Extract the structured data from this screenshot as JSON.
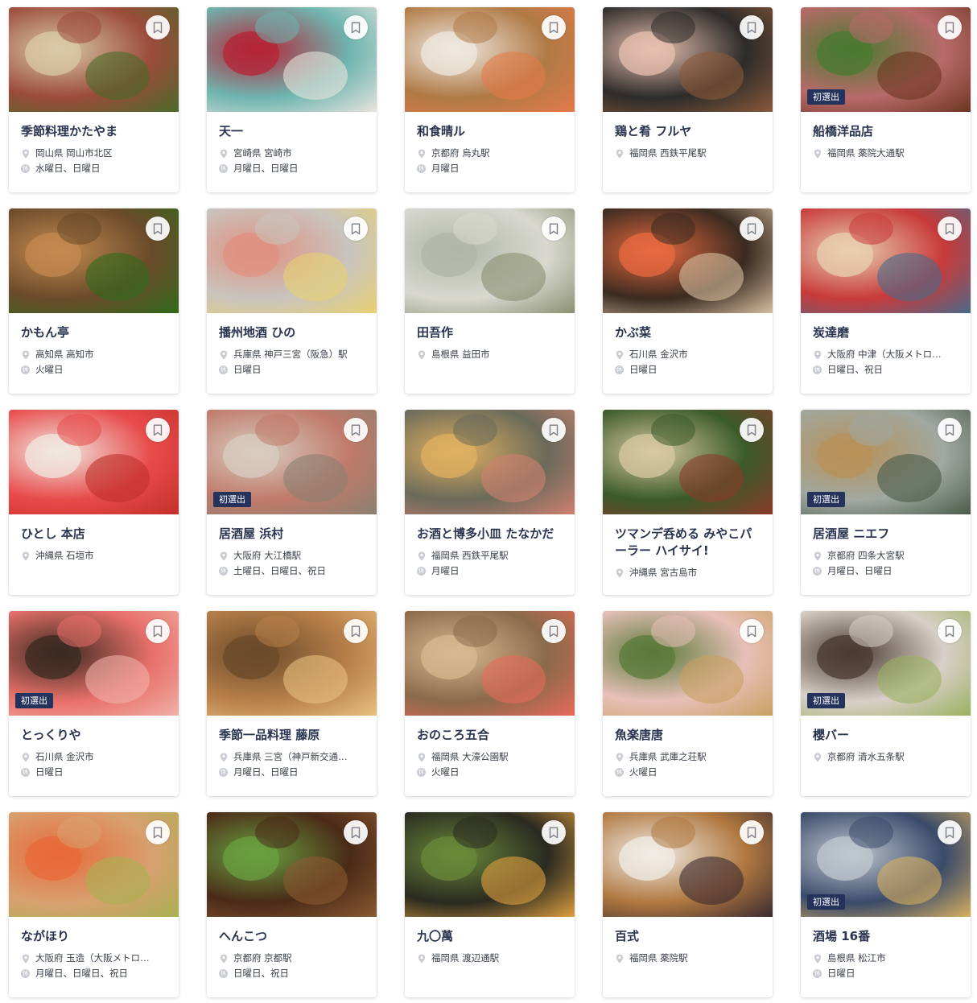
{
  "icons": {
    "bookmark": "bookmark-icon",
    "location": "location-pin-icon",
    "holiday": "holiday-icon"
  },
  "holiday_glyph": "休",
  "badge_label": "初選出",
  "colors": {
    "badge_bg": "#25325c",
    "name": "#2a3450"
  },
  "restaurants": [
    {
      "name": "季節料理かたやま",
      "location": "岡山県 岡山市北区",
      "holidays": "水曜日、日曜日",
      "badge": false,
      "palette": [
        "#9b4b3a",
        "#d9c9a8",
        "#4a6b2a"
      ]
    },
    {
      "name": "天一",
      "location": "宮崎県 宮崎市",
      "holidays": "月曜日、日曜日",
      "badge": false,
      "palette": [
        "#6fb5b0",
        "#b42436",
        "#e8e4dc"
      ]
    },
    {
      "name": "和食晴ル",
      "location": "京都府 烏丸駅",
      "holidays": "月曜日",
      "badge": false,
      "palette": [
        "#b07a45",
        "#efe8e0",
        "#e37a4a"
      ]
    },
    {
      "name": "鶏と肴 フルヤ",
      "location": "福岡県 西鉄平尾駅",
      "holidays": "",
      "badge": false,
      "palette": [
        "#2d2b2a",
        "#e8c0b0",
        "#8a5a3a"
      ]
    },
    {
      "name": "船橋洋品店",
      "location": "福岡県 薬院大通駅",
      "holidays": "",
      "badge": true,
      "palette": [
        "#b86a6a",
        "#4a7a30",
        "#6b3520"
      ]
    },
    {
      "name": "かもん亭",
      "location": "高知県 高知市",
      "holidays": "火曜日",
      "badge": false,
      "palette": [
        "#6a4a2a",
        "#c48a50",
        "#2f6a1a"
      ]
    },
    {
      "name": "播州地酒 ひの",
      "location": "兵庫県 神戸三宮（阪急）駅",
      "holidays": "日曜日",
      "badge": false,
      "palette": [
        "#c9c4be",
        "#e09080",
        "#e8d070"
      ]
    },
    {
      "name": "田吾作",
      "location": "島根県 益田市",
      "holidays": "",
      "badge": false,
      "palette": [
        "#d8d8d0",
        "#b0b6a8",
        "#8a9070"
      ]
    },
    {
      "name": "かぶ菜",
      "location": "石川県 金沢市",
      "holidays": "日曜日",
      "badge": false,
      "palette": [
        "#3a2a20",
        "#e86a40",
        "#d8c0a0"
      ]
    },
    {
      "name": "炭達磨",
      "location": "大阪府 中津（大阪メトロ…",
      "holidays": "日曜日、祝日",
      "badge": false,
      "palette": [
        "#c83a3a",
        "#e8d0b0",
        "#4a6a8a"
      ]
    },
    {
      "name": "ひとし 本店",
      "location": "沖縄県 石垣市",
      "holidays": "",
      "badge": false,
      "palette": [
        "#e84a4a",
        "#f0e8e0",
        "#c0302a"
      ]
    },
    {
      "name": "居酒屋 浜村",
      "location": "大阪府 大江橋駅",
      "holidays": "土曜日、日曜日、祝日",
      "badge": true,
      "palette": [
        "#c07a6a",
        "#d8ccc0",
        "#8a8070"
      ]
    },
    {
      "name": "お酒と博多小皿 たなかだ",
      "location": "福岡県 西鉄平尾駅",
      "holidays": "月曜日",
      "badge": false,
      "palette": [
        "#6a6a5a",
        "#e0b060",
        "#d08070"
      ]
    },
    {
      "name": "ツマンデ呑める みやこパーラー ハイサイ!",
      "location": "沖縄県 宮古島市",
      "holidays": "",
      "badge": false,
      "palette": [
        "#3a5a2a",
        "#d8c8a0",
        "#8a3a2a"
      ]
    },
    {
      "name": "居酒屋 ニエフ",
      "location": "京都府 四条大宮駅",
      "holidays": "月曜日、日曜日",
      "badge": true,
      "palette": [
        "#a0a8a0",
        "#b89058",
        "#4a5a4a"
      ]
    },
    {
      "name": "とっくりや",
      "location": "石川県 金沢市",
      "holidays": "日曜日",
      "badge": true,
      "palette": [
        "#e8706a",
        "#3a2a20",
        "#f0b0a8"
      ]
    },
    {
      "name": "季節一品料理 藤原",
      "location": "兵庫県 三宮（神戸新交通…",
      "holidays": "月曜日、日曜日",
      "badge": false,
      "palette": [
        "#b8804a",
        "#6a4a2a",
        "#e8c080"
      ]
    },
    {
      "name": "おのころ五合",
      "location": "福岡県 大濠公園駅",
      "holidays": "火曜日",
      "badge": false,
      "palette": [
        "#8a6a4a",
        "#d8b890",
        "#e86a5a"
      ]
    },
    {
      "name": "魚楽唐唐",
      "location": "兵庫県 武庫之荘駅",
      "holidays": "火曜日",
      "badge": false,
      "palette": [
        "#e8c0b8",
        "#5a7a3a",
        "#c8a060"
      ]
    },
    {
      "name": "櫻バー",
      "location": "京都府 清水五条駅",
      "holidays": "",
      "badge": true,
      "palette": [
        "#d8d0c8",
        "#4a3a30",
        "#9ab060"
      ]
    },
    {
      "name": "ながほり",
      "location": "大阪府 玉造（大阪メトロ…",
      "holidays": "月曜日、日曜日、祝日",
      "badge": false,
      "palette": [
        "#d8a070",
        "#e86a3a",
        "#a8b050"
      ]
    },
    {
      "name": "へんこつ",
      "location": "京都府 京都駅",
      "holidays": "日曜日、祝日",
      "badge": false,
      "palette": [
        "#4a2a18",
        "#6aa040",
        "#8a5a30"
      ]
    },
    {
      "name": "九〇萬",
      "location": "福岡県 渡辺通駅",
      "holidays": "",
      "badge": false,
      "palette": [
        "#2a2a20",
        "#6a8a3a",
        "#e0a040"
      ]
    },
    {
      "name": "百式",
      "location": "福岡県 薬院駅",
      "holidays": "",
      "badge": false,
      "palette": [
        "#b07840",
        "#f0ece6",
        "#3a2a30"
      ]
    },
    {
      "name": "酒場 16番",
      "location": "島根県 松江市",
      "holidays": "日曜日",
      "badge": true,
      "palette": [
        "#3a4a6a",
        "#c0c8d0",
        "#d8b060"
      ]
    }
  ]
}
